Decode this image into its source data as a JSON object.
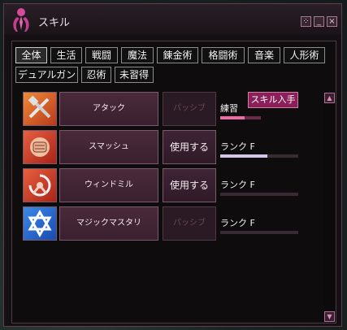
{
  "window": {
    "title": "スキル",
    "controls": [
      "⁘",
      "_",
      "×"
    ]
  },
  "tabs_row1": [
    "全体",
    "生活",
    "戦闘",
    "魔法",
    "錬金術",
    "格闘術",
    "音楽",
    "人形術"
  ],
  "tabs_row2": [
    "デュアルガン",
    "忍術",
    "未習得"
  ],
  "active_tab": "全体",
  "skills": [
    {
      "name": "アタック",
      "icon": "attack-icon",
      "use_label": "パッシブ",
      "use_enabled": false,
      "rank_label": "練習",
      "progress": 0.6,
      "acquire_label": "スキル入手"
    },
    {
      "name": "スマッシュ",
      "icon": "smash-icon",
      "use_label": "使用する",
      "use_enabled": true,
      "rank_label": "ランク F",
      "progress": 0.6
    },
    {
      "name": "ウィンドミル",
      "icon": "windmill-icon",
      "use_label": "使用する",
      "use_enabled": true,
      "rank_label": "ランク F",
      "progress": 0
    },
    {
      "name": "マジックマスタリ",
      "icon": "magic-mastery-icon",
      "use_label": "パッシブ",
      "use_enabled": false,
      "rank_label": "ランク F",
      "progress": 0
    }
  ],
  "colors": {
    "accent": "#8a1f5a",
    "progress_fill": "#d8c6e6",
    "panel_bg": "#0f0c0e"
  }
}
